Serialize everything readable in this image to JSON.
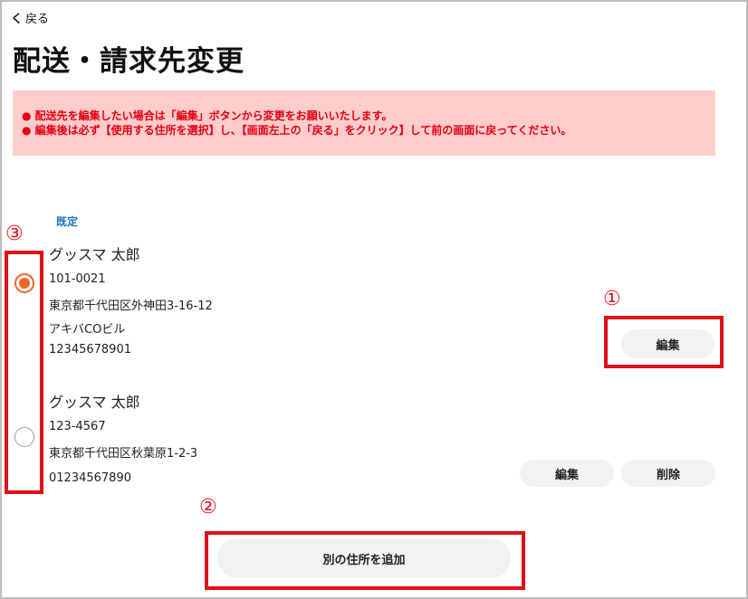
{
  "nav": {
    "back_label": "戻る",
    "back_chevron": "く"
  },
  "page": {
    "title": "配送・請求先変更"
  },
  "notice": {
    "lines": [
      "● 配送先を編集したい場合は「編集」ボタンから変更をお願いいたします。",
      "● 編集後は必ず【使用する住所を選択】し、【画面左上の「戻る」をクリック】して前の画面に戻ってください。"
    ]
  },
  "addresses": [
    {
      "default_tag": "既定",
      "name": "グッスマ 太郎",
      "postal": "101-0021",
      "address1": "東京都千代田区外神田3-16-12",
      "address2": "アキバCOビル",
      "phone": "12345678901",
      "selected": true,
      "edit_label": "編集"
    },
    {
      "name": "グッスマ 太郎",
      "postal": "123-4567",
      "address1": "東京都千代田区秋葉原1-2-3",
      "phone": "01234567890",
      "selected": false,
      "edit_label": "編集",
      "delete_label": "削除"
    }
  ],
  "add_address_label": "別の住所を追加",
  "annotations": {
    "one": "①",
    "two": "②",
    "three": "③"
  },
  "colors": {
    "accent_orange": "#f26522",
    "annotation_red": "#e0101a",
    "notice_bg": "#ffcccc",
    "notice_text": "#e60012",
    "default_tag": "#1a73c8"
  }
}
